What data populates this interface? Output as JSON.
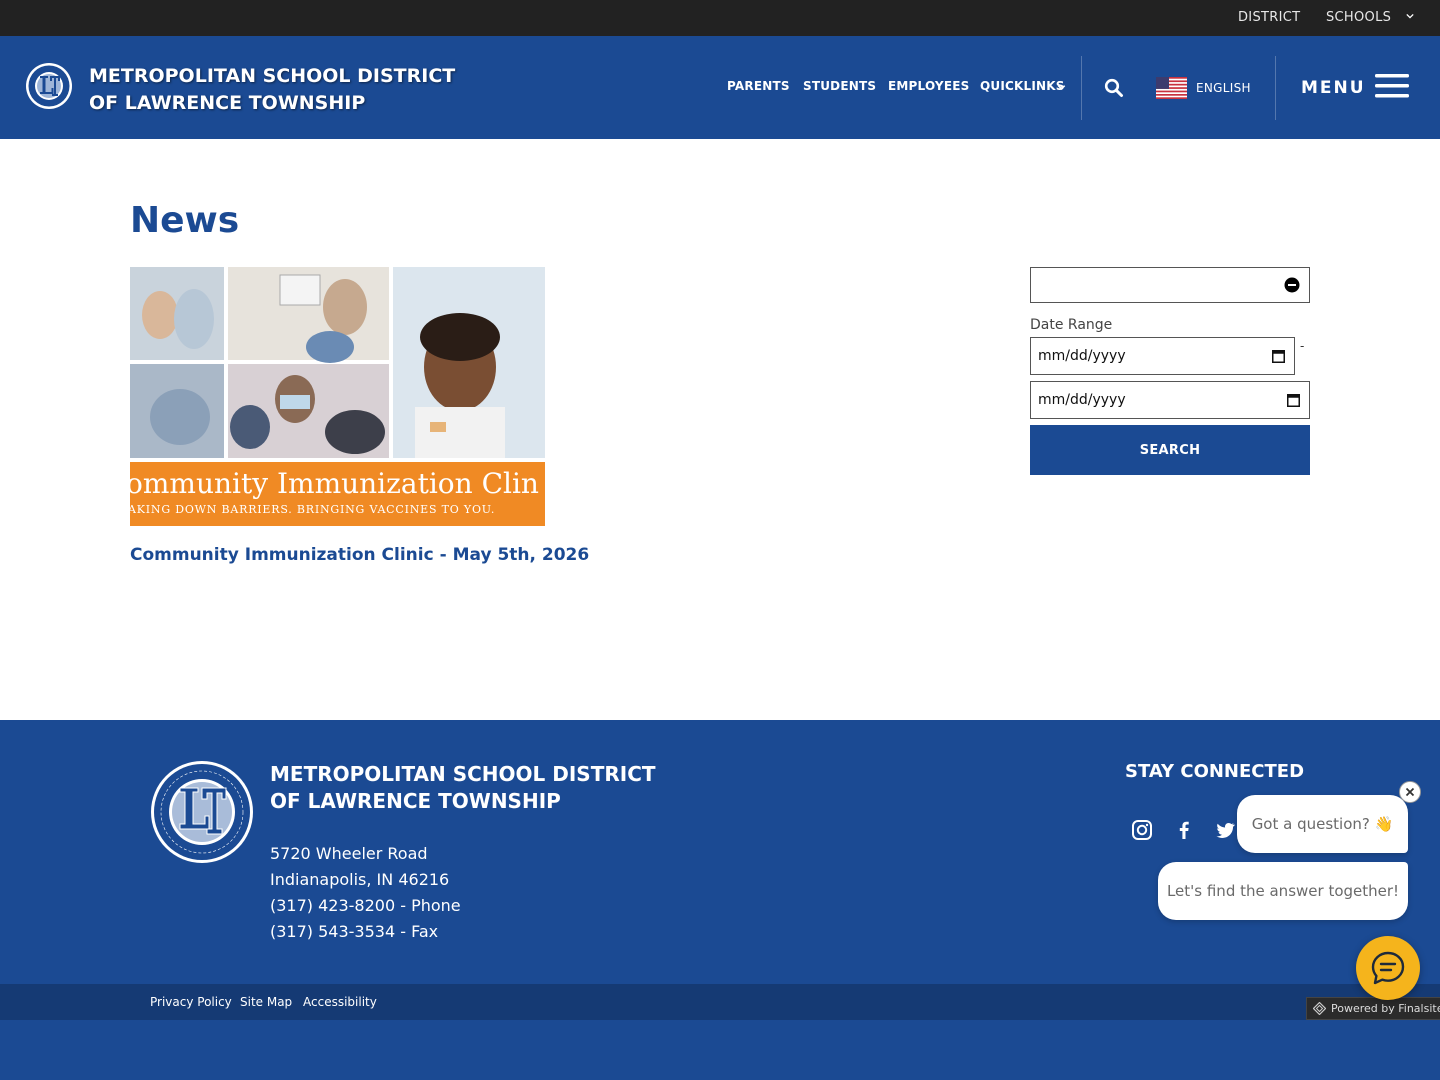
{
  "utility": {
    "district_label": "DISTRICT",
    "schools_label": "SCHOOLS"
  },
  "header": {
    "title_line1": "METROPOLITAN SCHOOL DISTRICT",
    "title_line2": "OF LAWRENCE TOWNSHIP",
    "nav": {
      "parents": "PARENTS",
      "students": "STUDENTS",
      "employees": "EMPLOYEES",
      "quicklinks": "QUICKLINKS"
    },
    "language": "ENGLISH",
    "menu_label": "MENU"
  },
  "main": {
    "page_title": "News",
    "news_items": [
      {
        "image_banner_line1": "ommunity Immunization Clin",
        "image_banner_line2": "AKING DOWN BARRIERS. BRINGING VACCINES TO YOU.",
        "headline": "Community Immunization Clinic - May 5th, 2026"
      }
    ],
    "filter": {
      "date_range_label": "Date Range",
      "start_placeholder": "mm/dd/yyyy",
      "end_placeholder": "mm/dd/yyyy",
      "separator": "-",
      "search_label": "SEARCH"
    }
  },
  "footer": {
    "title_line1": "METROPOLITAN SCHOOL DISTRICT",
    "title_line2": "OF LAWRENCE TOWNSHIP",
    "address_line1": "5720 Wheeler Road",
    "address_line2": "Indianapolis, IN  46216",
    "phone": "(317) 423-8200 - Phone",
    "fax": "(317) 543-3534 - Fax",
    "stay_connected": "STAY CONNECTED",
    "social_icons": [
      "instagram-icon",
      "facebook-icon",
      "twitter-icon"
    ]
  },
  "bottom_bar": {
    "privacy": "Privacy Policy",
    "sitemap": "Site Map",
    "accessibility": "Accessibility",
    "powered_by": "Powered by Finalsite"
  },
  "chat": {
    "bubble1": "Got a question? 👋",
    "bubble2": "Let's find the answer together!"
  },
  "colors": {
    "brand_blue": "#1b4a93",
    "utility_bar": "#222222",
    "banner_orange": "#f08a24",
    "chat_yellow": "#f5b41c"
  }
}
